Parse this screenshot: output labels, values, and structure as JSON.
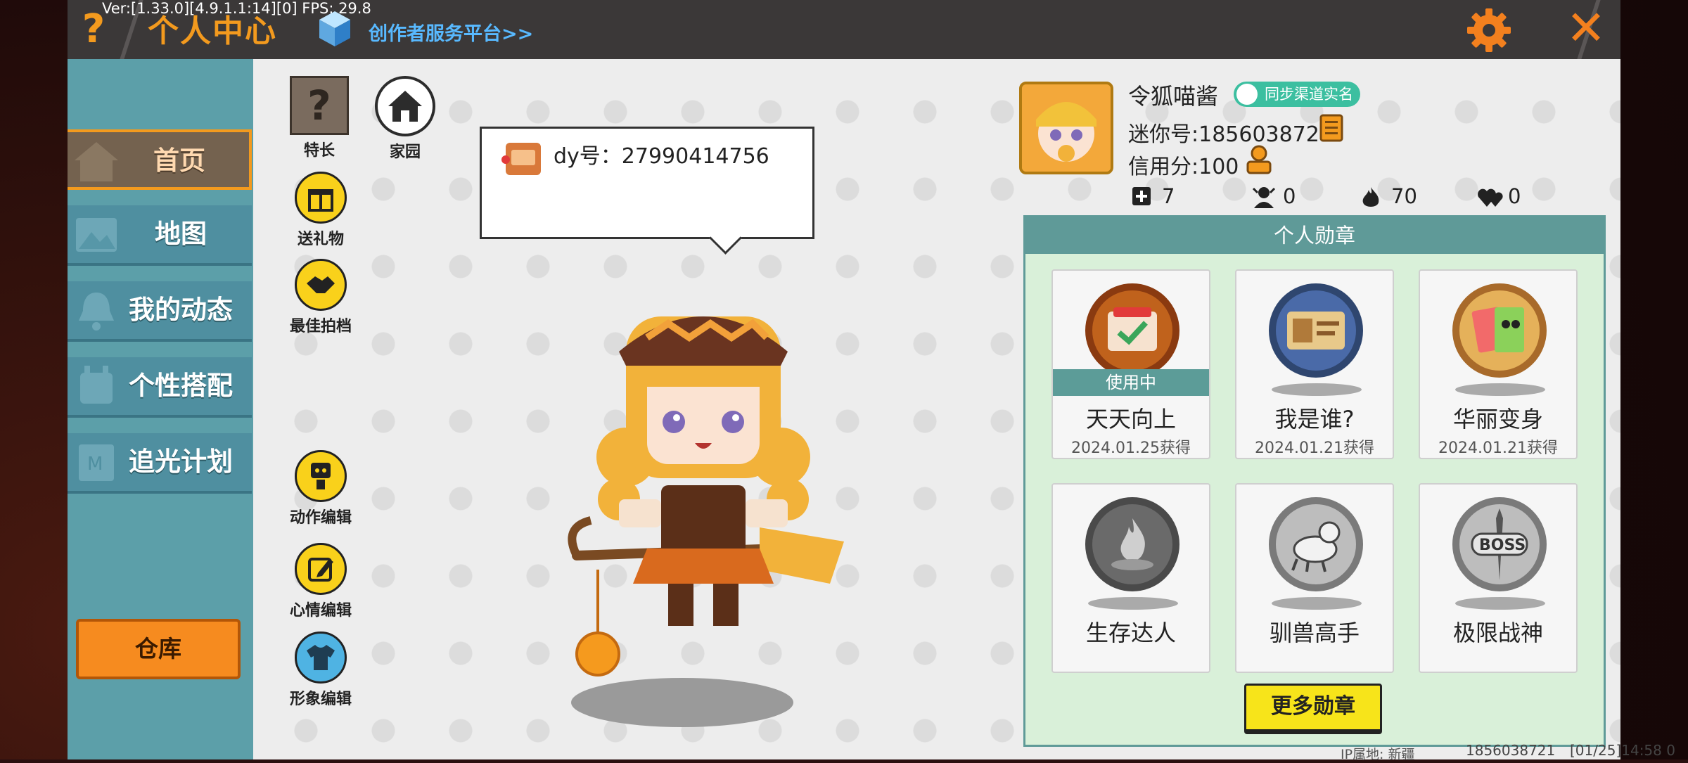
{
  "header": {
    "version": "Ver:[1.33.0][4.9.1.1:14][0] FPS: 29.8",
    "title": "个人中心",
    "creator_link": "创作者服务平台>>",
    "accent": "#f39a1e"
  },
  "sidebar": {
    "items": [
      {
        "label": "首页",
        "active": true
      },
      {
        "label": "地图"
      },
      {
        "label": "我的动态"
      },
      {
        "label": "个性搭配"
      },
      {
        "label": "追光计划"
      }
    ],
    "warehouse": "仓库"
  },
  "tools": {
    "specialty": "特长",
    "home": "家园",
    "gift": "送礼物",
    "partner": "最佳拍档",
    "action_edit": "动作编辑",
    "mood_edit": "心情编辑",
    "look_edit": "形象编辑"
  },
  "bubble": {
    "dy_label": "dy号：27990414756"
  },
  "profile": {
    "nickname": "令狐喵酱",
    "realname_badge": "同步渠道实名",
    "mini_id": "迷你号:1856038721",
    "credit": "信用分:100",
    "stats": {
      "posts": "7",
      "followers": "0",
      "heat": "70",
      "likes": "0"
    }
  },
  "medals": {
    "header": "个人勋章",
    "in_use_label": "使用中",
    "items": [
      {
        "name": "天天向上",
        "date": "2024.01.25获得",
        "in_use": true
      },
      {
        "name": "我是谁?",
        "date": "2024.01.21获得"
      },
      {
        "name": "华丽变身",
        "date": "2024.01.21获得"
      },
      {
        "name": "生存达人",
        "date": ""
      },
      {
        "name": "驯兽高手",
        "date": ""
      },
      {
        "name": "极限战神",
        "date": ""
      }
    ],
    "more_button": "更多勋章"
  },
  "footer": {
    "ip": "IP属地: 新疆",
    "user_id": "1856038721",
    "time": "[01/25]14:58 0"
  }
}
